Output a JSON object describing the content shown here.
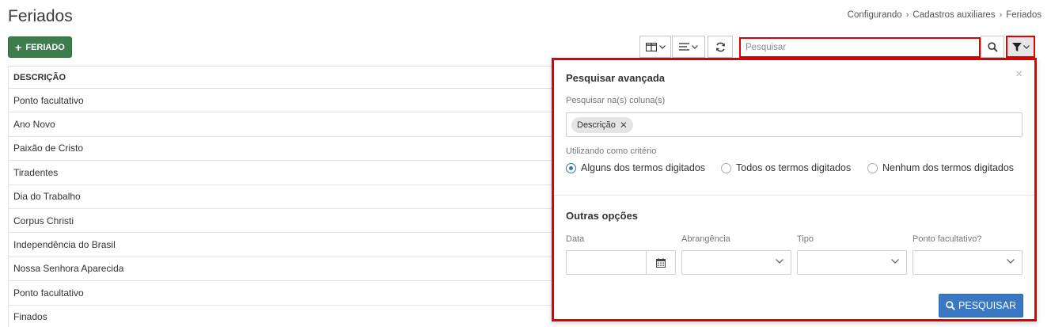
{
  "page": {
    "title": "Feriados"
  },
  "breadcrumb": {
    "items": [
      "Configurando",
      "Cadastros auxiliares",
      "Feriados"
    ]
  },
  "toolbar": {
    "add_label": "FERIADO",
    "search_placeholder": "Pesquisar"
  },
  "table": {
    "header": "DESCRIÇÃO",
    "rows": [
      "Ponto facultativo",
      "Ano Novo",
      "Paixão de Cristo",
      "Tiradentes",
      "Dia do Trabalho",
      "Corpus Christi",
      "Independência do Brasil",
      "Nossa Senhora Aparecida",
      "Ponto facultativo",
      "Finados"
    ]
  },
  "advanced_search": {
    "title": "Pesquisar avançada",
    "columns_label": "Pesquisar na(s) coluna(s)",
    "selected_chip": "Descrição",
    "criteria_label": "Utilizando como critério",
    "criteria_options": [
      {
        "label": "Alguns dos termos digitados",
        "checked": true
      },
      {
        "label": "Todos os termos digitados",
        "checked": false
      },
      {
        "label": "Nenhum dos termos digitados",
        "checked": false
      }
    ],
    "other_title": "Outras opções",
    "fields": {
      "date": "Data",
      "scope": "Abrangência",
      "type": "Tipo",
      "optional": "Ponto facultativo?"
    },
    "submit_label": "PESQUISAR"
  },
  "colors": {
    "primary": "#3a78c3",
    "success": "#3f7d4e",
    "highlight": "#e00000"
  }
}
